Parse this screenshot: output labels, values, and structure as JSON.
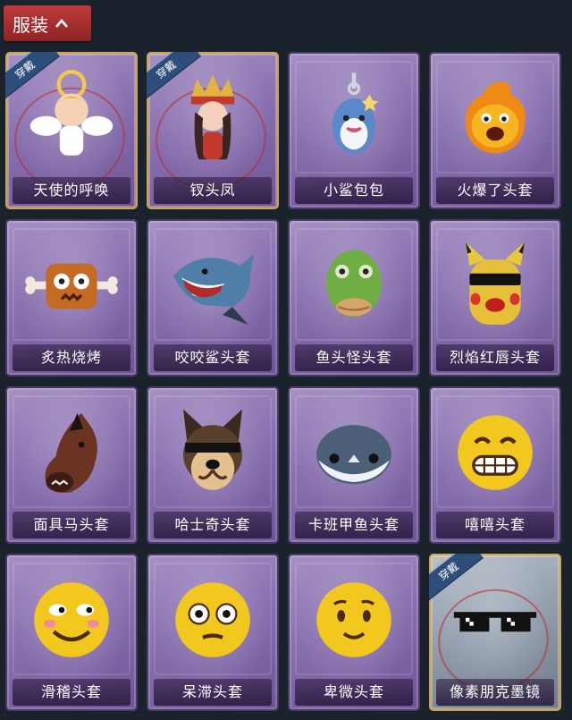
{
  "header": {
    "title": "服装"
  },
  "items": [
    {
      "label": "天使的呼唤",
      "badge": "穿戴",
      "worn": true,
      "icon": "angel-costume-icon"
    },
    {
      "label": "钗头凤",
      "badge": "穿戴",
      "worn": true,
      "icon": "phoenix-crown-costume-icon"
    },
    {
      "label": "小鲨包包",
      "badge": "",
      "worn": false,
      "icon": "shark-bag-icon"
    },
    {
      "label": "火爆了头套",
      "badge": "",
      "worn": false,
      "icon": "fire-head-icon"
    },
    {
      "label": "炙热烧烤",
      "badge": "",
      "worn": false,
      "icon": "bbq-meat-icon"
    },
    {
      "label": "咬咬鲨头套",
      "badge": "",
      "worn": false,
      "icon": "shark-head-icon"
    },
    {
      "label": "鱼头怪头套",
      "badge": "",
      "worn": false,
      "icon": "fish-head-icon"
    },
    {
      "label": "烈焰红唇头套",
      "badge": "",
      "worn": false,
      "icon": "red-lips-head-icon"
    },
    {
      "label": "面具马头套",
      "badge": "",
      "worn": false,
      "icon": "horse-head-icon"
    },
    {
      "label": "哈士奇头套",
      "badge": "",
      "worn": false,
      "icon": "husky-head-icon"
    },
    {
      "label": "卡班甲鱼头套",
      "badge": "",
      "worn": false,
      "icon": "turtle-head-icon"
    },
    {
      "label": "嘻嘻头套",
      "badge": "",
      "worn": false,
      "icon": "grin-emoji-head-icon"
    },
    {
      "label": "滑稽头套",
      "badge": "",
      "worn": false,
      "icon": "funny-emoji-head-icon"
    },
    {
      "label": "呆滞头套",
      "badge": "",
      "worn": false,
      "icon": "stunned-emoji-head-icon"
    },
    {
      "label": "卑微头套",
      "badge": "",
      "worn": false,
      "icon": "humble-emoji-head-icon"
    },
    {
      "label": "像素朋克墨镜",
      "badge": "穿戴",
      "worn": true,
      "icon": "pixel-sunglasses-icon"
    }
  ]
}
